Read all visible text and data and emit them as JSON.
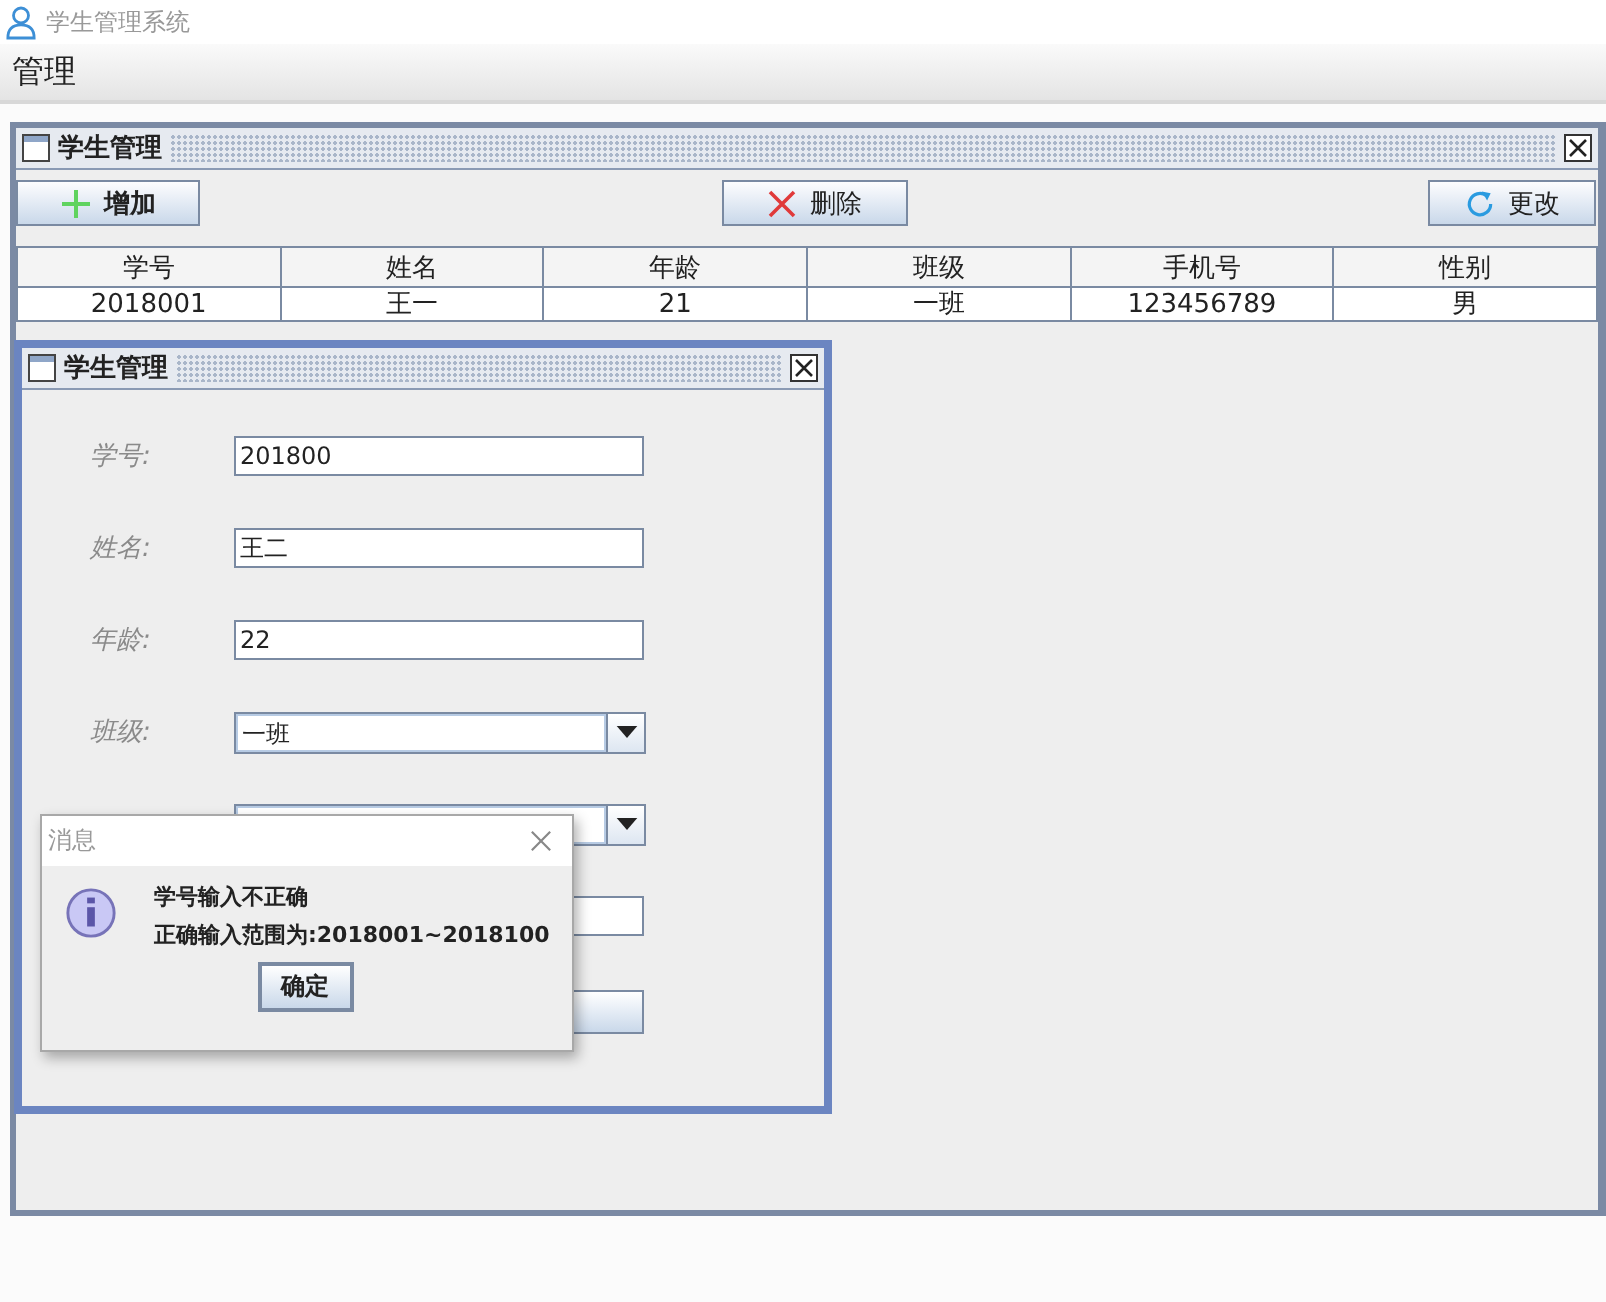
{
  "app": {
    "title": "学生管理系统"
  },
  "menu": [
    {
      "label": "管理"
    }
  ],
  "main_frame": {
    "title": "学生管理",
    "buttons": [
      {
        "label": "增加",
        "kind": "add"
      },
      {
        "label": "删除",
        "kind": "delete"
      },
      {
        "label": "更改",
        "kind": "refresh"
      }
    ],
    "table": {
      "columns": [
        "学号",
        "姓名",
        "年龄",
        "班级",
        "手机号",
        "性别"
      ],
      "rows": [
        [
          "2018001",
          "王一",
          "21",
          "一班",
          "123456789",
          "男"
        ]
      ]
    }
  },
  "form_frame": {
    "title": "学生管理",
    "fields": [
      {
        "kind": "text",
        "label": "学号:",
        "value": "201800"
      },
      {
        "kind": "text",
        "label": "姓名:",
        "value": "王二"
      },
      {
        "kind": "text",
        "label": "年龄:",
        "value": "22"
      },
      {
        "kind": "combo",
        "label": "班级:",
        "value": "一班"
      },
      {
        "kind": "combo"
      },
      {
        "kind": "text"
      },
      {
        "kind": "button"
      }
    ]
  },
  "dialog": {
    "title": "消息",
    "lines": [
      "学号输入不正确",
      "正确输入范围为:2018001~2018100"
    ],
    "button": "确定"
  }
}
